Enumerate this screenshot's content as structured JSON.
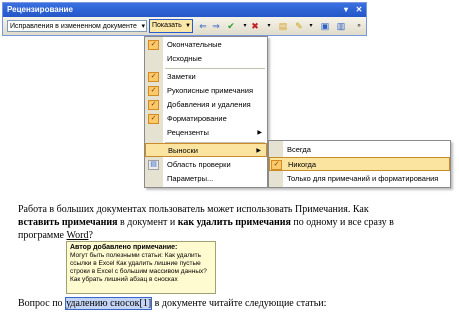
{
  "toolbar": {
    "title": "Рецензирование",
    "mode_value": "Исправления в измененном документе",
    "show_label": "Показать"
  },
  "menu": {
    "items": [
      {
        "label": "Окончательные",
        "checked": true
      },
      {
        "label": "Исходные",
        "checked": false
      },
      {
        "label": "Заметки",
        "checked": true
      },
      {
        "label": "Рукописные примечания",
        "checked": true
      },
      {
        "label": "Добавления и удаления",
        "checked": true
      },
      {
        "label": "Форматирование",
        "checked": true
      },
      {
        "label": "Рецензенты",
        "checked": false,
        "submenu": true
      },
      {
        "label": "Выноски",
        "checked": false,
        "submenu": true,
        "highlighted": true
      },
      {
        "label": "Область проверки",
        "checked": false
      },
      {
        "label": "Параметры...",
        "checked": false
      }
    ]
  },
  "submenu": {
    "items": [
      {
        "label": "Всегда",
        "checked": false
      },
      {
        "label": "Никогда",
        "checked": true,
        "highlighted": true
      },
      {
        "label": "Только для примечаний и форматирования",
        "checked": false
      }
    ]
  },
  "document": {
    "p1_a": "Работа в больших документах пользователь может использовать Примечания. Как",
    "p1_b_bold1": "вставить примечания",
    "p1_b_mid": " в документ и ",
    "p1_b_bold2": "как удалить примечания",
    "p1_b_end": " по одному и все сразу в",
    "p1_c_pre": "программе ",
    "p1_c_word": "Word",
    "p1_c_post": "?",
    "comment_author": "Автор добавлено примечание:",
    "comment_body": "Могут быть полезными статьи: Как удалить ссылки в Excel Как удалить лишние пустые строки в Excel с большим массивом данных? Как убрать лишний абзац в сносках",
    "p2_pre": "Вопрос по ",
    "p2_sel": "удалению сносок",
    "p2_ref": "[1]",
    "p2_post": " в документе читайте следующие статьи:"
  }
}
